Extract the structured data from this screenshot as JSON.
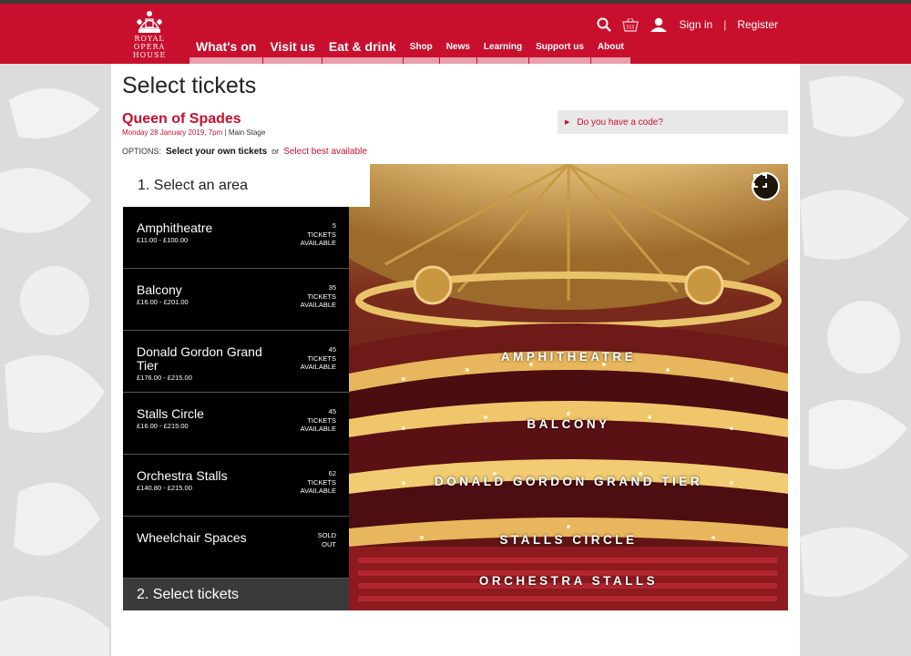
{
  "header": {
    "logo_lines": [
      "ROYAL",
      "OPERA",
      "HOUSE"
    ],
    "nav": [
      {
        "label": "What's on",
        "size": "big"
      },
      {
        "label": "Visit us",
        "size": "big"
      },
      {
        "label": "Eat & drink",
        "size": "big"
      },
      {
        "label": "Shop",
        "size": "small"
      },
      {
        "label": "News",
        "size": "small"
      },
      {
        "label": "Learning",
        "size": "small"
      },
      {
        "label": "Support us",
        "size": "small"
      },
      {
        "label": "About",
        "size": "small"
      }
    ],
    "sign_in": "Sign in",
    "separator": "|",
    "register": "Register",
    "icons": [
      "search-icon",
      "basket-icon",
      "user-icon"
    ]
  },
  "page": {
    "title": "Select tickets",
    "show_title": "Queen of Spades",
    "show_date": "Monday 28 January 2019, 7pm",
    "meta_separator": "|",
    "show_stage": "Main Stage",
    "options_label": "OPTIONS:",
    "option_current": "Select your own tickets",
    "option_or": "or",
    "option_alt": "Select best available",
    "code_prompt": "Do you have a code?"
  },
  "selector": {
    "step1": "1.  Select an area",
    "step2": "2.  Select tickets",
    "areas": [
      {
        "name": "Amphitheatre",
        "price": "£11.00 - £100.00",
        "avail": [
          "5",
          "TICKETS",
          "AVAILABLE"
        ]
      },
      {
        "name": "Balcony",
        "price": "£16.00 - £201.00",
        "avail": [
          "35",
          "TICKETS",
          "AVAILABLE"
        ]
      },
      {
        "name": "Donald Gordon Grand Tier",
        "price": "£176.00 - £215.00",
        "avail": [
          "45",
          "TICKETS",
          "AVAILABLE"
        ]
      },
      {
        "name": "Stalls Circle",
        "price": "£16.00 - £215.00",
        "avail": [
          "45",
          "TICKETS",
          "AVAILABLE"
        ]
      },
      {
        "name": "Orchestra Stalls",
        "price": "£140.80 - £215.00",
        "avail": [
          "62",
          "TICKETS",
          "AVAILABLE"
        ]
      },
      {
        "name": "Wheelchair Spaces",
        "price": "",
        "avail": [
          "SOLD",
          "OUT"
        ]
      }
    ]
  },
  "theatre": {
    "labels": [
      "AMPHITHEATRE",
      "BALCONY",
      "DONALD GORDON GRAND TIER",
      "STALLS CIRCLE",
      "ORCHESTRA STALLS"
    ]
  },
  "colors": {
    "brand": "#c8102e",
    "nav_underline": "#e9a0ac",
    "panel": "#000000",
    "gold": "#e0b45a"
  }
}
